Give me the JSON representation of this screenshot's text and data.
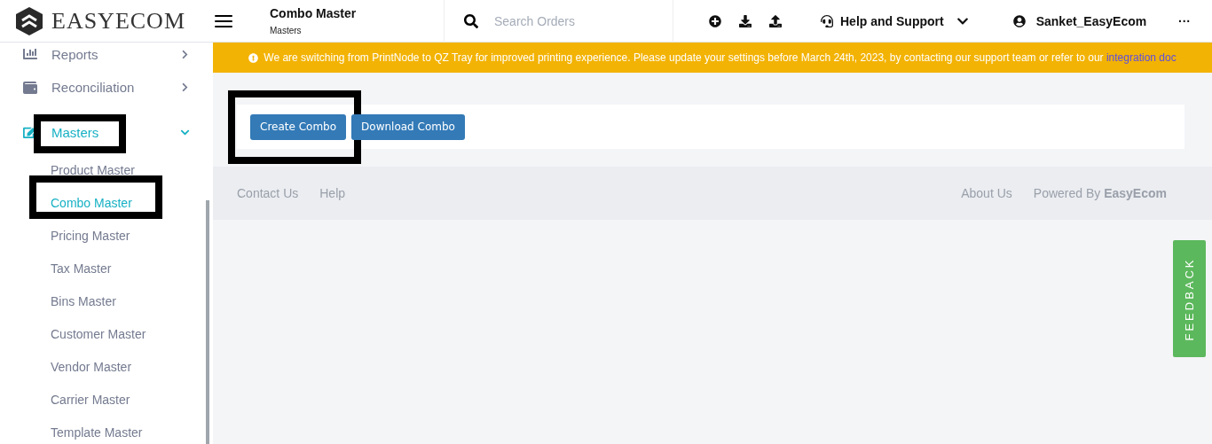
{
  "header": {
    "logo": "EASYECOM",
    "page_title": "Combo Master",
    "breadcrumb": "Masters",
    "search": {
      "placeholder": "Search Orders"
    },
    "help": "Help and Support",
    "user": "Sanket_EasyEcom",
    "more": "···"
  },
  "sidebar": {
    "items": [
      {
        "label": "Reports",
        "expanded": false,
        "selected": false,
        "annotated": false
      },
      {
        "label": "Reconciliation",
        "expanded": false,
        "selected": false,
        "annotated": false
      },
      {
        "label": "Masters",
        "expanded": true,
        "selected": true,
        "annotated": true,
        "children": [
          {
            "label": "Product Master",
            "selected": false,
            "annotated": false
          },
          {
            "label": "Combo Master",
            "selected": true,
            "annotated": true
          },
          {
            "label": "Pricing Master",
            "selected": false,
            "annotated": false
          },
          {
            "label": "Tax Master",
            "selected": false,
            "annotated": false
          },
          {
            "label": "Bins Master",
            "selected": false,
            "annotated": false
          },
          {
            "label": "Customer Master",
            "selected": false,
            "annotated": false
          },
          {
            "label": "Vendor Master",
            "selected": false,
            "annotated": false
          },
          {
            "label": "Carrier Master",
            "selected": false,
            "annotated": false
          },
          {
            "label": "Template Master",
            "selected": false,
            "annotated": false
          }
        ]
      }
    ]
  },
  "notice": {
    "text": "We are switching from PrintNode to QZ Tray for improved printing experience. Please update your settings before March 24th, 2023, by contacting our support team or refer to our",
    "link": "integration doc"
  },
  "actions": [
    {
      "label": "Create Combo",
      "annotated": true
    },
    {
      "label": "Download Combo"
    }
  ],
  "footer": {
    "left": [
      "Contact Us",
      "Help"
    ],
    "about": "About Us",
    "powered": "Powered By **EasyEcom**"
  },
  "feedback": "FEEDBACK"
}
